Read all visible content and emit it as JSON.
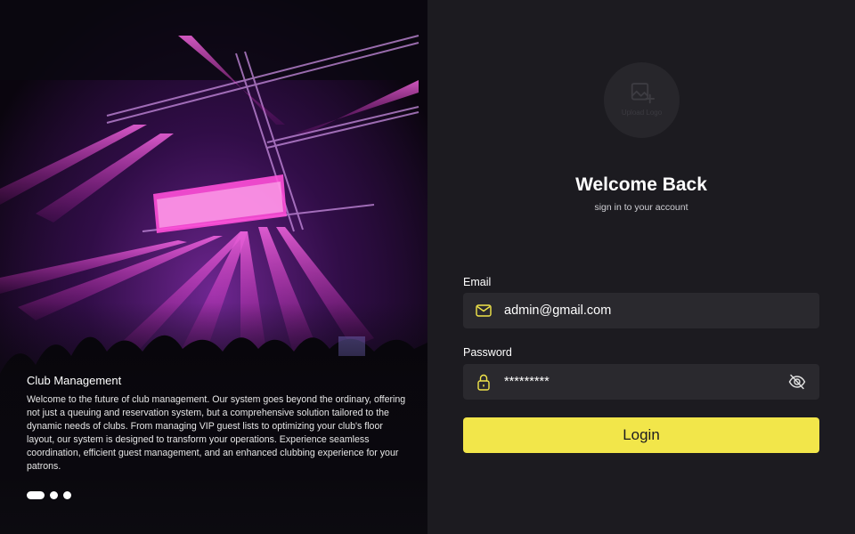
{
  "hero": {
    "title": "Club Management",
    "description": "Welcome to the future of club management. Our system goes beyond the ordinary, offering not just a queuing and reservation system, but a comprehensive solution tailored to the dynamic needs of clubs. From managing VIP guest lists to optimizing your club's floor layout, our system is designed to transform your operations. Experience seamless coordination, efficient guest management, and an enhanced clubbing experience for your patrons.",
    "carousel": {
      "total": 3,
      "active": 1
    }
  },
  "logo_upload": {
    "label": "Upload Logo",
    "icon": "image-upload-icon"
  },
  "welcome": {
    "title": "Welcome Back",
    "subtitle": "sign in to your account"
  },
  "form": {
    "email": {
      "label": "Email",
      "value": "admin@gmail.com",
      "icon": "mail-icon"
    },
    "password": {
      "label": "Password",
      "value": "*********",
      "icon": "lock-icon",
      "toggle_icon": "eye-off-icon"
    },
    "submit_label": "Login"
  },
  "colors": {
    "accent": "#f2e64a",
    "panel_bg": "#1c1b20",
    "field_bg": "#2a292e",
    "beam": "#ff3fd8"
  }
}
